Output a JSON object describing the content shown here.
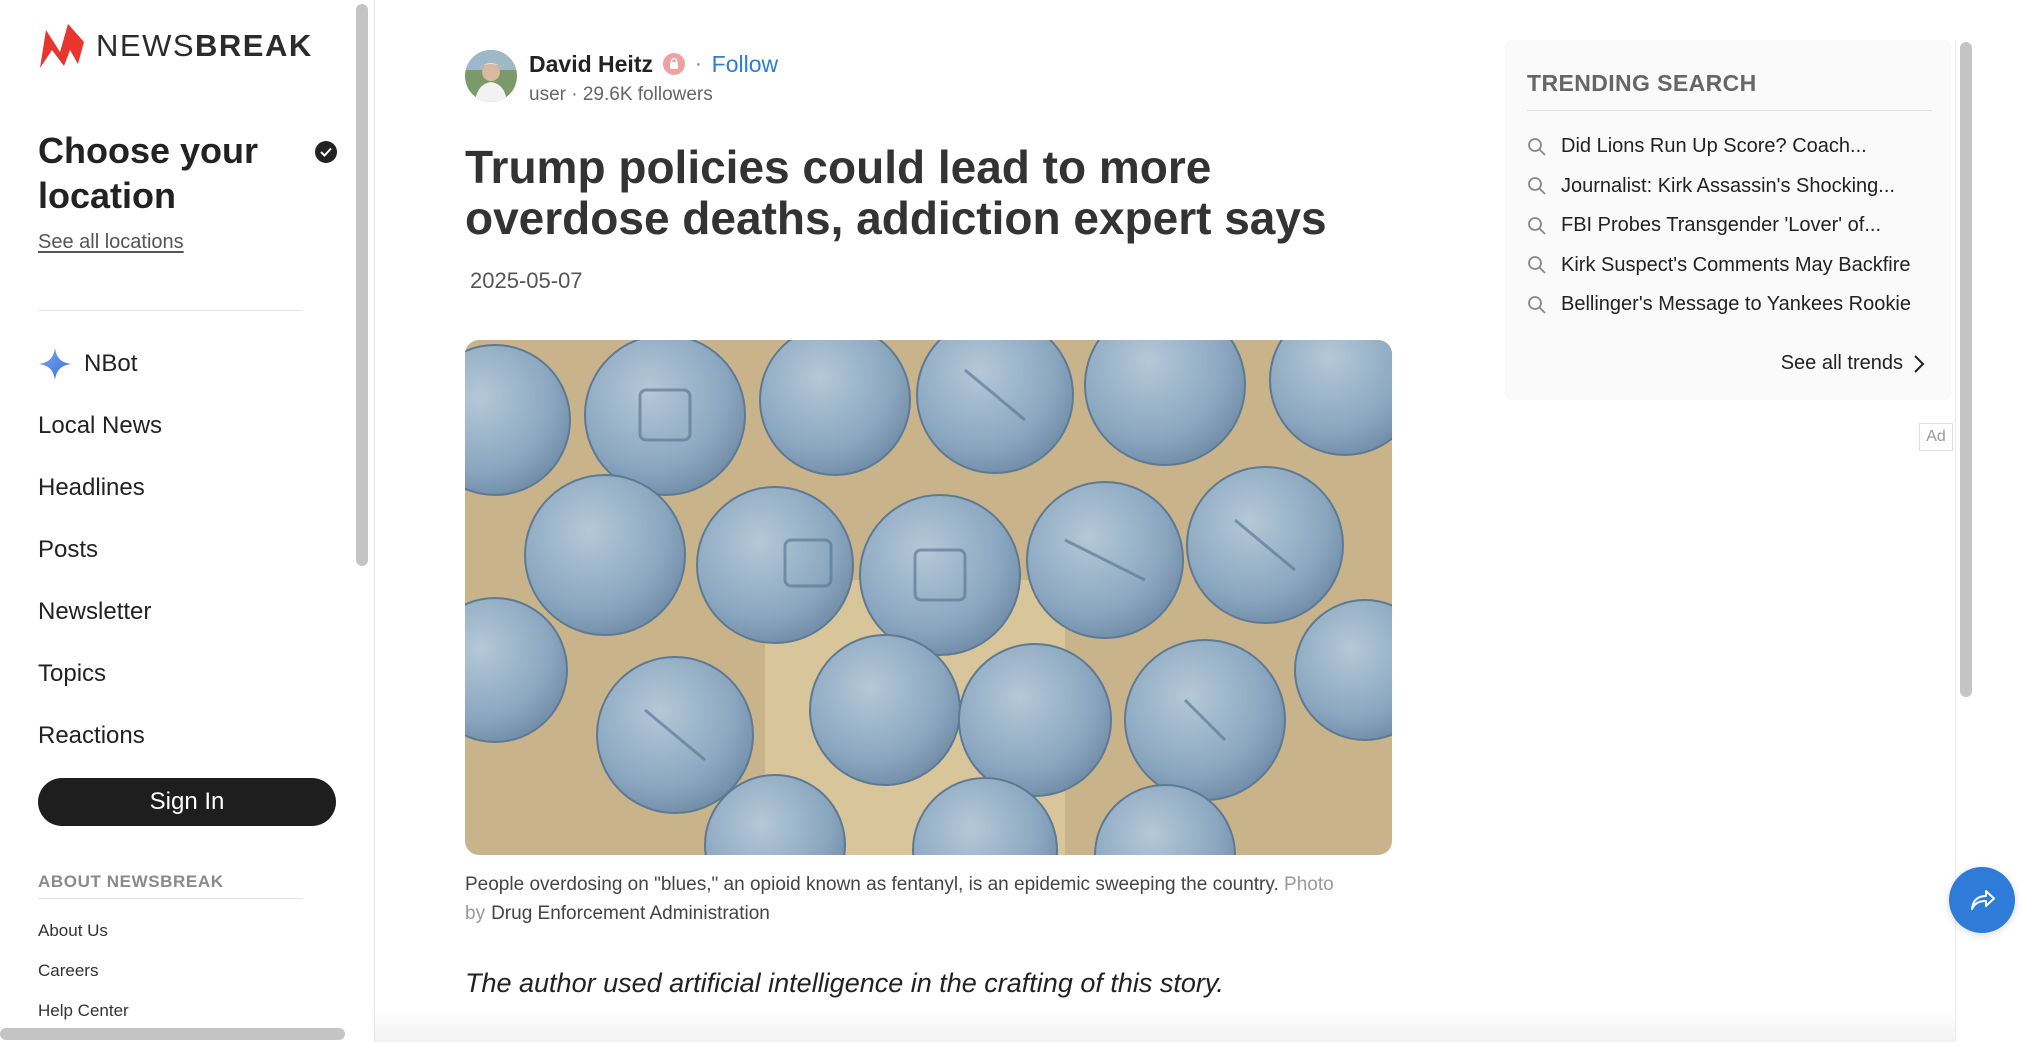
{
  "brand": {
    "name_prefix": "NEWS",
    "name_suffix": "BREAK",
    "logo_color": "#e8352d"
  },
  "location": {
    "title": "Choose your location",
    "link": "See all locations"
  },
  "nav": {
    "items": [
      {
        "label": "NBot",
        "icon": "sparkle-icon"
      },
      {
        "label": "Local News"
      },
      {
        "label": "Headlines"
      },
      {
        "label": "Posts"
      },
      {
        "label": "Newsletter"
      },
      {
        "label": "Topics"
      },
      {
        "label": "Reactions"
      }
    ]
  },
  "signin": {
    "label": "Sign In"
  },
  "about": {
    "heading": "ABOUT NEWSBREAK",
    "links": [
      "About Us",
      "Careers",
      "Help Center"
    ]
  },
  "article": {
    "author": {
      "name": "David Heitz",
      "follow_label": "Follow",
      "separator": "·",
      "meta": "user · 29.6K followers"
    },
    "headline": "Trump policies could lead to more overdose deaths, addiction expert says",
    "date": "2025-05-07",
    "caption": {
      "text": "People overdosing on \"blues,\" an opioid known as fentanyl, is an epidemic sweeping the country.",
      "photo_by_1": "Photo",
      "photo_by_2": "by",
      "credit": "Drug Enforcement Administration"
    },
    "ai_note": "The author used artificial intelligence in the crafting of this story."
  },
  "trending": {
    "title": "TRENDING SEARCH",
    "items": [
      "Did Lions Run Up Score? Coach...",
      "Journalist: Kirk Assassin's Shocking...",
      "FBI Probes Transgender 'Lover' of...",
      "Kirk Suspect's Comments May Backfire",
      "Bellinger's Message to Yankees Rookie"
    ],
    "see_all": "See all trends"
  },
  "ad": {
    "label": "Ad"
  },
  "colors": {
    "accent": "#2f7bd8",
    "dark_button": "#1e1e1e"
  }
}
